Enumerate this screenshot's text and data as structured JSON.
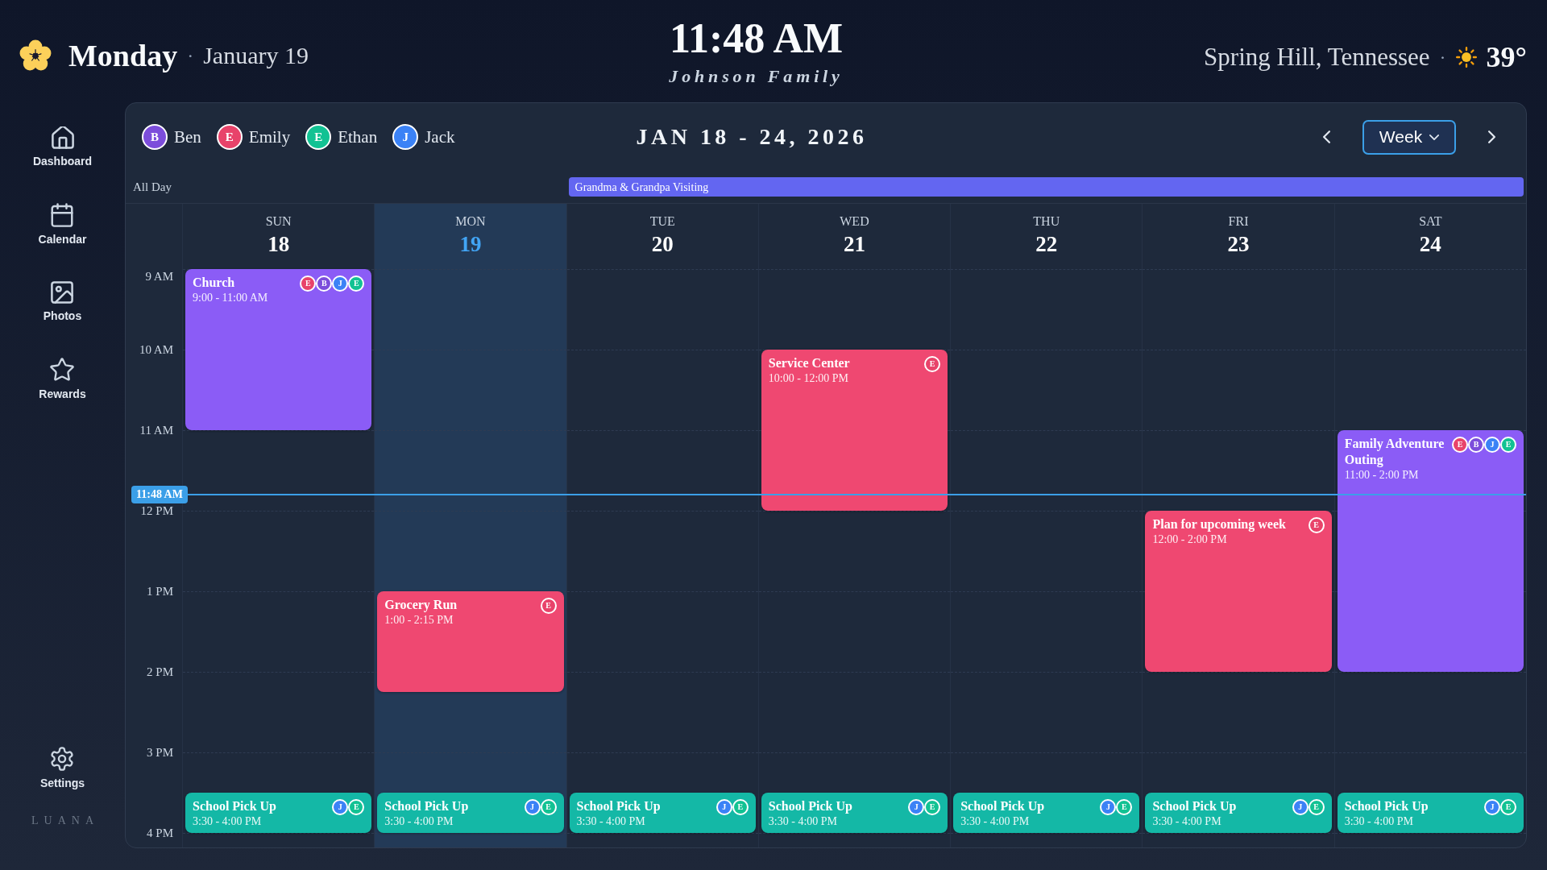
{
  "header": {
    "day": "Monday",
    "day_separator": "·",
    "date": "January 19",
    "time": "11:48 AM",
    "family": "Johnson Family",
    "location": "Spring Hill, Tennessee",
    "weather_separator": "·",
    "temperature": "39°"
  },
  "sidebar": {
    "items": [
      {
        "label": "Dashboard"
      },
      {
        "label": "Calendar"
      },
      {
        "label": "Photos"
      },
      {
        "label": "Rewards"
      }
    ],
    "settings": {
      "label": "Settings"
    },
    "brand": "LUANA"
  },
  "calendar": {
    "members": [
      {
        "initial": "B",
        "name": "Ben",
        "color": "#7c4ddb"
      },
      {
        "initial": "E",
        "name": "Emily",
        "color": "#e8436a"
      },
      {
        "initial": "E",
        "name": "Ethan",
        "color": "#12c293"
      },
      {
        "initial": "J",
        "name": "Jack",
        "color": "#3b82f6"
      }
    ],
    "range": "JAN 18 - 24, 2026",
    "view": "Week",
    "all_day_label": "All Day",
    "time_labels": [
      "9 AM",
      "10 AM",
      "11 AM",
      "12 PM",
      "1 PM",
      "2 PM",
      "3 PM",
      "4 PM"
    ],
    "now": {
      "label": "11:48 AM"
    },
    "days": [
      {
        "name": "SUN",
        "date": "18",
        "selected": false,
        "events": [
          {
            "title": "Church",
            "time": "9:00 - 11:00 AM",
            "color": "#8b5cf6",
            "members": [
              {
                "initial": "E",
                "color": "#e8436a"
              },
              {
                "initial": "B",
                "color": "#7c4ddb"
              },
              {
                "initial": "J",
                "color": "#3b82f6"
              },
              {
                "initial": "E",
                "color": "#12c293"
              }
            ]
          },
          {
            "title": "School Pick Up",
            "time": "3:30 - 4:00 PM",
            "color": "#14b8a6",
            "members": [
              {
                "initial": "J",
                "color": "#3b82f6"
              },
              {
                "initial": "E",
                "color": "#12c293"
              }
            ]
          }
        ]
      },
      {
        "name": "MON",
        "date": "19",
        "selected": true,
        "events": [
          {
            "title": "Grocery Run",
            "time": "1:00 - 2:15 PM",
            "color": "#ef4871",
            "members": [
              {
                "initial": "E",
                "color": "#e8436a"
              }
            ]
          },
          {
            "title": "School Pick Up",
            "time": "3:30 - 4:00 PM",
            "color": "#14b8a6",
            "members": [
              {
                "initial": "J",
                "color": "#3b82f6"
              },
              {
                "initial": "E",
                "color": "#12c293"
              }
            ]
          }
        ]
      },
      {
        "name": "TUE",
        "date": "20",
        "selected": false,
        "all_day_events": [
          {
            "title": "Grandma & Grandpa Visiting",
            "color": "#6366f1",
            "multi_day": true
          }
        ],
        "events": [
          {
            "title": "School Pick Up",
            "time": "3:30 - 4:00 PM",
            "color": "#14b8a6",
            "members": [
              {
                "initial": "J",
                "color": "#3b82f6"
              },
              {
                "initial": "E",
                "color": "#12c293"
              }
            ]
          }
        ]
      },
      {
        "name": "WED",
        "date": "21",
        "selected": false,
        "events": [
          {
            "title": "Service Center",
            "time": "10:00 - 12:00 PM",
            "color": "#ef4871",
            "members": [
              {
                "initial": "E",
                "color": "#e8436a"
              }
            ]
          },
          {
            "title": "School Pick Up",
            "time": "3:30 - 4:00 PM",
            "color": "#14b8a6",
            "members": [
              {
                "initial": "J",
                "color": "#3b82f6"
              },
              {
                "initial": "E",
                "color": "#12c293"
              }
            ]
          }
        ]
      },
      {
        "name": "THU",
        "date": "22",
        "selected": false,
        "events": [
          {
            "title": "School Pick Up",
            "time": "3:30 - 4:00 PM",
            "color": "#14b8a6",
            "members": [
              {
                "initial": "J",
                "color": "#3b82f6"
              },
              {
                "initial": "E",
                "color": "#12c293"
              }
            ]
          }
        ]
      },
      {
        "name": "FRI",
        "date": "23",
        "selected": false,
        "events": [
          {
            "title": "Plan for upcoming week",
            "time": "12:00 - 2:00 PM",
            "color": "#ef4871",
            "members": [
              {
                "initial": "E",
                "color": "#e8436a"
              }
            ]
          },
          {
            "title": "School Pick Up",
            "time": "3:30 - 4:00 PM",
            "color": "#14b8a6",
            "members": [
              {
                "initial": "J",
                "color": "#3b82f6"
              },
              {
                "initial": "E",
                "color": "#12c293"
              }
            ]
          }
        ]
      },
      {
        "name": "SAT",
        "date": "24",
        "selected": false,
        "events": [
          {
            "title": "Family Adventure Outing",
            "time": "11:00 - 2:00 PM",
            "color": "#8b5cf6",
            "members": [
              {
                "initial": "E",
                "color": "#e8436a"
              },
              {
                "initial": "B",
                "color": "#7c4ddb"
              },
              {
                "initial": "J",
                "color": "#3b82f6"
              },
              {
                "initial": "E",
                "color": "#12c293"
              }
            ]
          },
          {
            "title": "School Pick Up",
            "time": "3:30 - 4:00 PM",
            "color": "#14b8a6",
            "members": [
              {
                "initial": "J",
                "color": "#3b82f6"
              },
              {
                "initial": "E",
                "color": "#12c293"
              }
            ]
          }
        ]
      }
    ]
  }
}
